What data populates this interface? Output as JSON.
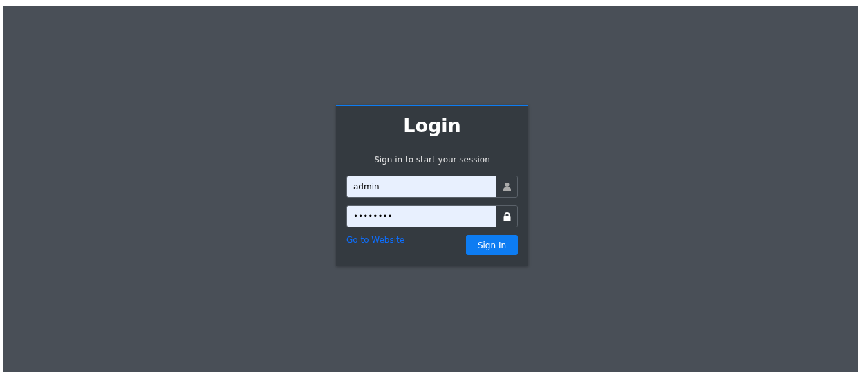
{
  "card": {
    "title": "Login",
    "subtitle": "Sign in to start your session"
  },
  "fields": [
    {
      "kind": "user",
      "value": "admin"
    },
    {
      "kind": "password",
      "value": "••••••••"
    }
  ],
  "link": "Go to Website",
  "button": "Sign In"
}
